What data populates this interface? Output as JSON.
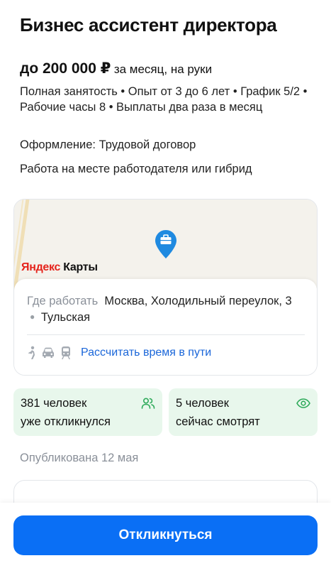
{
  "job": {
    "title": "Бизнес ассистент директора",
    "salary_amount": "до 200 000 ₽",
    "salary_note": "за месяц, на руки",
    "details": "Полная занятость • Опыт от 3 до 6 лет • График 5/2 • Рабочие часы 8 • Выплаты два раза в месяц",
    "registration": "Оформление: Трудовой договор",
    "work_place": "Работа на месте работодателя или гибрид"
  },
  "map": {
    "brand_part1": "Яндекс",
    "brand_part2": " Карты",
    "pin_icon": "briefcase-pin-icon",
    "address_label": "Где работать",
    "address": "Москва, Холодильный переулок, 3",
    "metro_station": "Тульская",
    "metro_color": "#9aa0a6",
    "transport_icons": [
      "walk-icon",
      "car-icon",
      "train-icon"
    ],
    "route_link": "Рассчитать время в пути"
  },
  "stats": [
    {
      "line1": "381 человек",
      "line2": "уже откликнулся",
      "icon": "people-icon"
    },
    {
      "line1": "5 человек",
      "line2": "сейчас смотрят",
      "icon": "eye-icon"
    }
  ],
  "published": "Опубликована 12 мая",
  "action": {
    "respond_label": "Откликнуться"
  },
  "colors": {
    "accent": "#0a6ff5",
    "link": "#1a66d9",
    "stat_bg": "#e8f7ec",
    "stat_icon": "#2eaa5a",
    "map_pin": "#1f8ae0"
  }
}
